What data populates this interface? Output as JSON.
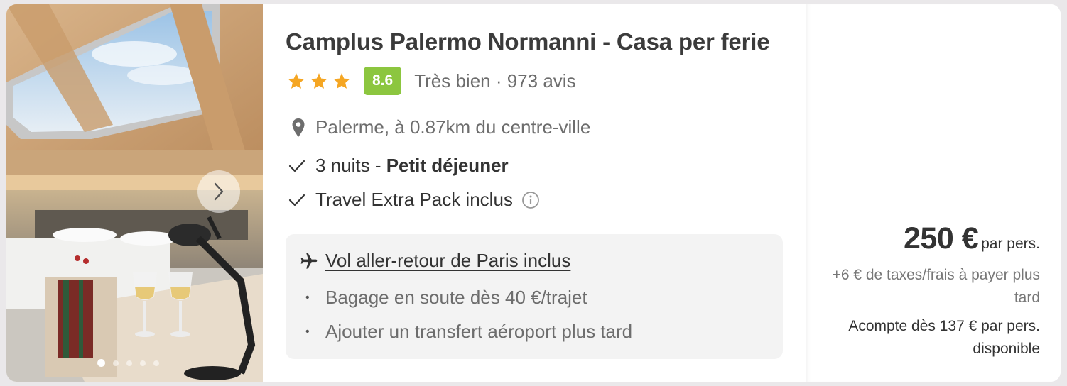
{
  "hotel": {
    "name": "Camplus Palermo Normanni - Casa per ferie",
    "stars": 3,
    "score": "8.6",
    "rating_text": "Très bien · 973 avis",
    "location": "Palerme, à 0.87km du centre-ville"
  },
  "features": {
    "nights_prefix": "3 nuits - ",
    "board": "Petit déjeuner",
    "extra_pack": "Travel Extra Pack inclus"
  },
  "flight": {
    "title": "Vol aller-retour de Paris inclus",
    "baggage": "Bagage en soute dès 40 €/trajet",
    "transfer": "Ajouter un transfert aéroport plus tard"
  },
  "pricing": {
    "price": "250 €",
    "per_person": "par pers.",
    "taxes": "+6 € de taxes/frais à payer plus tard",
    "deposit": "Acompte dès 137 € par pers. disponible"
  },
  "gallery": {
    "image_count": 5,
    "active_index": 0
  },
  "colors": {
    "score_badge": "#8cc63f",
    "star": "#f5a623",
    "card_bg": "#ffffff",
    "page_bg": "#eae8ea"
  },
  "icons": [
    "star-icon",
    "location-pin-icon",
    "check-icon",
    "info-icon",
    "plane-icon",
    "chevron-right-icon"
  ]
}
